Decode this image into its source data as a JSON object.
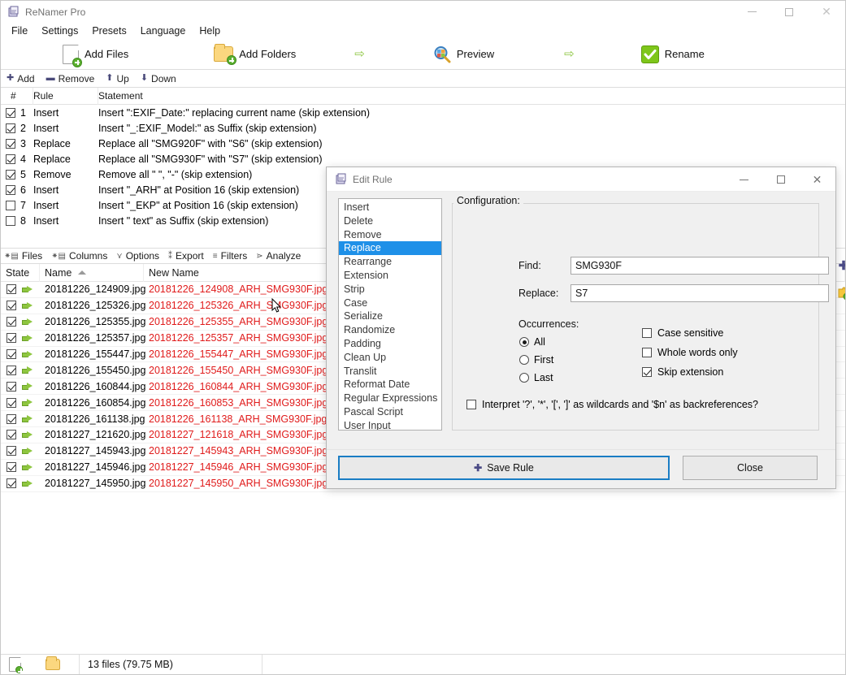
{
  "window": {
    "title": "ReNamer Pro",
    "app_icon": "renamer-app-icon",
    "controls": {
      "minimize": "minimize-icon",
      "maximize": "maximize-icon",
      "close": "close-icon"
    }
  },
  "menubar": {
    "items": [
      {
        "label": "File"
      },
      {
        "label": "Settings"
      },
      {
        "label": "Presets"
      },
      {
        "label": "Language"
      },
      {
        "label": "Help"
      }
    ]
  },
  "toolbar": {
    "add_files": "Add Files",
    "add_folders": "Add Folders",
    "preview": "Preview",
    "rename": "Rename",
    "arrow1": "⇨",
    "arrow2": "⇨"
  },
  "rules_toolbar": {
    "add": "Add",
    "remove": "Remove",
    "up": "Up",
    "down": "Down"
  },
  "rules_panel": {
    "columns": {
      "num": "#",
      "rule": "Rule",
      "statement": "Statement"
    },
    "rows": [
      {
        "num": "1",
        "checked": true,
        "rule": "Insert",
        "statement": "Insert \":EXIF_Date:\" replacing current name (skip extension)"
      },
      {
        "num": "2",
        "checked": true,
        "rule": "Insert",
        "statement": "Insert \"_:EXIF_Model:\" as Suffix (skip extension)"
      },
      {
        "num": "3",
        "checked": true,
        "rule": "Replace",
        "statement": "Replace all \"SMG920F\" with \"S6\" (skip extension)"
      },
      {
        "num": "4",
        "checked": true,
        "rule": "Replace",
        "statement": "Replace all \"SMG930F\" with \"S7\" (skip extension)"
      },
      {
        "num": "5",
        "checked": true,
        "rule": "Remove",
        "statement": "Remove all \" \", \"-\" (skip extension)"
      },
      {
        "num": "6",
        "checked": true,
        "rule": "Insert",
        "statement": "Insert \"_ARH\" at Position 16 (skip extension)"
      },
      {
        "num": "7",
        "checked": false,
        "rule": "Insert",
        "statement": "Insert \"_EKP\" at Position 16 (skip extension)"
      },
      {
        "num": "8",
        "checked": false,
        "rule": "Insert",
        "statement": "Insert \" text\" as Suffix (skip extension)"
      }
    ]
  },
  "files_toolbar": {
    "items": [
      {
        "label": "Files",
        "icon": "files-icon"
      },
      {
        "label": "Columns",
        "icon": "columns-icon"
      },
      {
        "label": "Options",
        "icon": "options-icon"
      },
      {
        "label": "Export",
        "icon": "export-icon"
      },
      {
        "label": "Filters",
        "icon": "filters-icon"
      },
      {
        "label": "Analyze",
        "icon": "analyze-icon"
      }
    ]
  },
  "files_panel": {
    "columns": {
      "state": "State",
      "name": "Name",
      "new_name": "New Name"
    },
    "sort": "ascending",
    "rows": [
      {
        "checked": true,
        "name": "20181226_124909.jpg",
        "new_name": "20181226_124908_ARH_SMG930F.jpg"
      },
      {
        "checked": true,
        "name": "20181226_125326.jpg",
        "new_name": "20181226_125326_ARH_SMG930F.jpg"
      },
      {
        "checked": true,
        "name": "20181226_125355.jpg",
        "new_name": "20181226_125355_ARH_SMG930F.jpg"
      },
      {
        "checked": true,
        "name": "20181226_125357.jpg",
        "new_name": "20181226_125357_ARH_SMG930F.jpg"
      },
      {
        "checked": true,
        "name": "20181226_155447.jpg",
        "new_name": "20181226_155447_ARH_SMG930F.jpg"
      },
      {
        "checked": true,
        "name": "20181226_155450.jpg",
        "new_name": "20181226_155450_ARH_SMG930F.jpg"
      },
      {
        "checked": true,
        "name": "20181226_160844.jpg",
        "new_name": "20181226_160844_ARH_SMG930F.jpg"
      },
      {
        "checked": true,
        "name": "20181226_160854.jpg",
        "new_name": "20181226_160853_ARH_SMG930F.jpg"
      },
      {
        "checked": true,
        "name": "20181226_161138.jpg",
        "new_name": "20181226_161138_ARH_SMG930F.jpg"
      },
      {
        "checked": true,
        "name": "20181227_121620.jpg",
        "new_name": "20181227_121618_ARH_SMG930F.jpg"
      },
      {
        "checked": true,
        "name": "20181227_145943.jpg",
        "new_name": "20181227_145943_ARH_SMG930F.jpg"
      },
      {
        "checked": true,
        "name": "20181227_145946.jpg",
        "new_name": "20181227_145946_ARH_SMG930F.jpg"
      },
      {
        "checked": true,
        "name": "20181227_145950.jpg",
        "new_name": "20181227_145950_ARH_SMG930F.jpg"
      }
    ]
  },
  "statusbar": {
    "add_files_icon": "add-file-icon",
    "add_folder_icon": "add-folder-icon",
    "summary": "13 files (79.75 MB)"
  },
  "dialog": {
    "title": "Edit Rule",
    "icon": "edit-rule-icon",
    "controls": {
      "minimize": "minimize-icon",
      "maximize": "maximize-icon",
      "close": "close-icon"
    },
    "rule_types": [
      {
        "label": "Insert",
        "selected": false
      },
      {
        "label": "Delete",
        "selected": false
      },
      {
        "label": "Remove",
        "selected": false
      },
      {
        "label": "Replace",
        "selected": true
      },
      {
        "label": "Rearrange",
        "selected": false
      },
      {
        "label": "Extension",
        "selected": false
      },
      {
        "label": "Strip",
        "selected": false
      },
      {
        "label": "Case",
        "selected": false
      },
      {
        "label": "Serialize",
        "selected": false
      },
      {
        "label": "Randomize",
        "selected": false
      },
      {
        "label": "Padding",
        "selected": false
      },
      {
        "label": "Clean Up",
        "selected": false
      },
      {
        "label": "Translit",
        "selected": false
      },
      {
        "label": "Reformat Date",
        "selected": false
      },
      {
        "label": "Regular Expressions",
        "selected": false
      },
      {
        "label": "Pascal Script",
        "selected": false
      },
      {
        "label": "User Input",
        "selected": false
      }
    ],
    "config": {
      "legend": "Configuration:",
      "find_label": "Find:",
      "find_value": "SMG930F",
      "replace_label": "Replace:",
      "replace_value": "S7",
      "occurrences_label": "Occurrences:",
      "occurrences": [
        {
          "label": "All",
          "selected": true
        },
        {
          "label": "First",
          "selected": false
        },
        {
          "label": "Last",
          "selected": false
        }
      ],
      "checkboxes": [
        {
          "label": "Case sensitive",
          "checked": false
        },
        {
          "label": "Whole words only",
          "checked": false
        },
        {
          "label": "Skip extension",
          "checked": true
        }
      ],
      "wildcards_label": "Interpret '?', '*', '[', ']' as wildcards and '$n' as backreferences?",
      "wildcards_checked": false
    },
    "footer": {
      "save_label": "Save Rule",
      "close_label": "Close"
    }
  },
  "colors": {
    "selection_blue": "#1e90e8",
    "new_name_red": "#e01b1b",
    "green_arrow": "#8ec63f",
    "primary_border": "#1a7dc4"
  }
}
